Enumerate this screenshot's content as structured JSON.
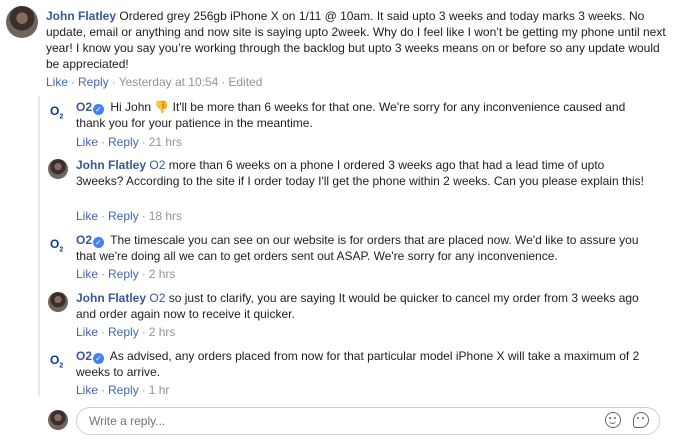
{
  "comments": [
    {
      "author": "John Flatley",
      "text": "Ordered grey 256gb iPhone X on 1/11 @ 10am. It said upto 3 weeks and today marks 3 weeks. No update, email or anything and now site is saying upto 2week. Why do I feel like I won’t be getting my phone until next year! I know you say you’re working through the backlog but upto 3 weeks means on or before so any update would be appreciated!",
      "like_label": "Like",
      "reply_label": "Reply",
      "time": "Yesterday at 10:54",
      "edited": "Edited"
    }
  ],
  "replies": [
    {
      "author": "O2",
      "verified": true,
      "mention": "",
      "text": "Hi John 👎 It'll be more than 6 weeks for that one. We're sorry for any inconvenience caused and thank you for your patience in the meantime.",
      "like_label": "Like",
      "reply_label": "Reply",
      "time": "21 hrs"
    },
    {
      "author": "John Flatley",
      "verified": false,
      "mention": "O2",
      "text": "more than 6 weeks on a phone I ordered 3 weeks ago that had a lead time of upto 3weeks? According to the site if I order today I'll get the phone within 2 weeks. Can you please explain this!",
      "like_label": "Like",
      "reply_label": "Reply",
      "time": "18 hrs"
    },
    {
      "author": "O2",
      "verified": true,
      "mention": "",
      "text": "The timescale you can see on our website is for orders that are placed now. We'd like to assure you that we're doing all we can to get orders sent out ASAP. We're sorry for any inconvenience.",
      "like_label": "Like",
      "reply_label": "Reply",
      "time": "2 hrs"
    },
    {
      "author": "John Flatley",
      "verified": false,
      "mention": "O2",
      "text": "so just to clarify, you are saying It would be quicker to cancel my order from 3 weeks ago and order again now to receive it quicker.",
      "like_label": "Like",
      "reply_label": "Reply",
      "time": "2 hrs"
    },
    {
      "author": "O2",
      "verified": true,
      "mention": "",
      "text": "As advised, any orders placed from now for that particular model iPhone X will take a maximum of 2 weeks to arrive.",
      "like_label": "Like",
      "reply_label": "Reply",
      "time": "1 hr"
    }
  ],
  "reply_box": {
    "placeholder": "Write a reply..."
  },
  "icons": {
    "emoji": "emoji-icon",
    "sticker": "sticker-icon",
    "verified": "verified-badge-icon"
  },
  "colors": {
    "link": "#385898",
    "meta": "#90949c",
    "verified": "#4080ff"
  }
}
